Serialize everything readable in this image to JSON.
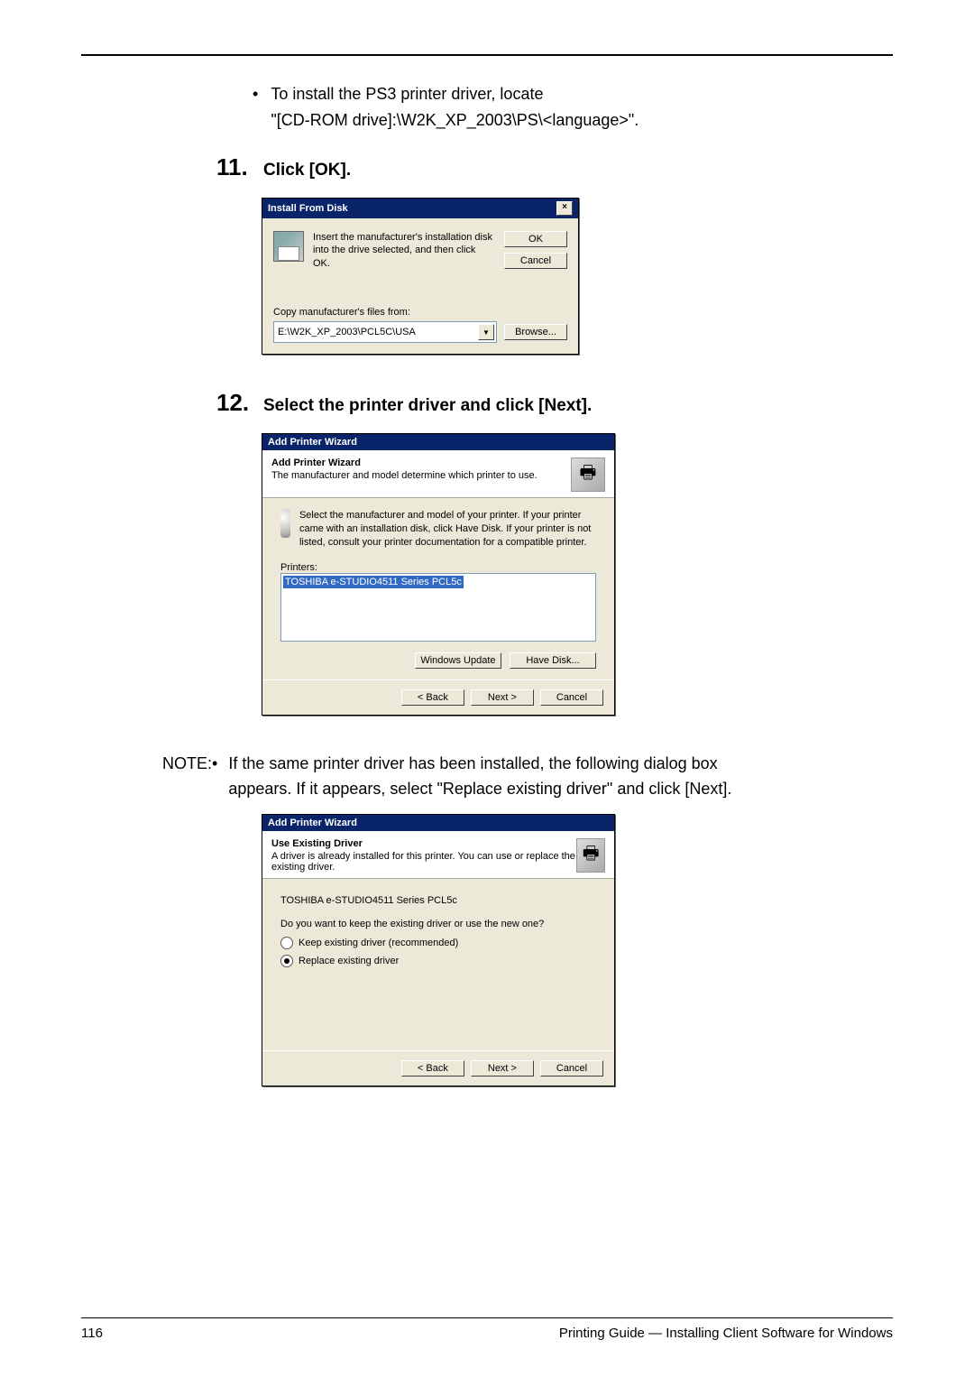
{
  "bullet1_line1": "To install the PS3 printer driver, locate",
  "bullet1_line2": "\"[CD-ROM drive]:\\W2K_XP_2003\\PS\\<language>\".",
  "step11_num": "11.",
  "step11_text": "Click [OK].",
  "step12_num": "12.",
  "step12_text": "Select the printer driver and click [Next].",
  "d1": {
    "title": "Install From Disk",
    "message": "Insert the manufacturer's installation disk into the drive selected, and then click OK.",
    "ok": "OK",
    "cancel": "Cancel",
    "copy_label": "Copy manufacturer's files from:",
    "path": "E:\\W2K_XP_2003\\PCL5C\\USA",
    "browse": "Browse..."
  },
  "wiz1": {
    "window_title": "Add Printer Wizard",
    "h1": "Add Printer Wizard",
    "h2": "The manufacturer and model determine which printer to use.",
    "info": "Select the manufacturer and model of your printer. If your printer came with an installation disk, click Have Disk. If your printer is not listed, consult your printer documentation for a compatible printer.",
    "printers_label": "Printers:",
    "printer_item": "TOSHIBA e-STUDIO4511 Series PCL5c",
    "windows_update": "Windows Update",
    "have_disk": "Have Disk...",
    "back": "< Back",
    "next": "Next >",
    "cancel": "Cancel"
  },
  "note_label": "NOTE:",
  "note_text": "If the same printer driver has been installed, the following dialog box appears.  If it appears, select \"Replace existing driver\" and click [Next].",
  "wiz2": {
    "window_title": "Add Printer Wizard",
    "h1": "Use Existing Driver",
    "h2": "A driver is already installed for this printer. You can use or replace the existing driver.",
    "model": "TOSHIBA e-STUDIO4511 Series PCL5c",
    "question": "Do you want to keep the existing driver or use the new one?",
    "keep": "Keep existing driver (recommended)",
    "replace": "Replace existing driver",
    "back": "< Back",
    "next": "Next >",
    "cancel": "Cancel"
  },
  "footer_page": "116",
  "footer_text": "Printing Guide — Installing Client Software for Windows"
}
